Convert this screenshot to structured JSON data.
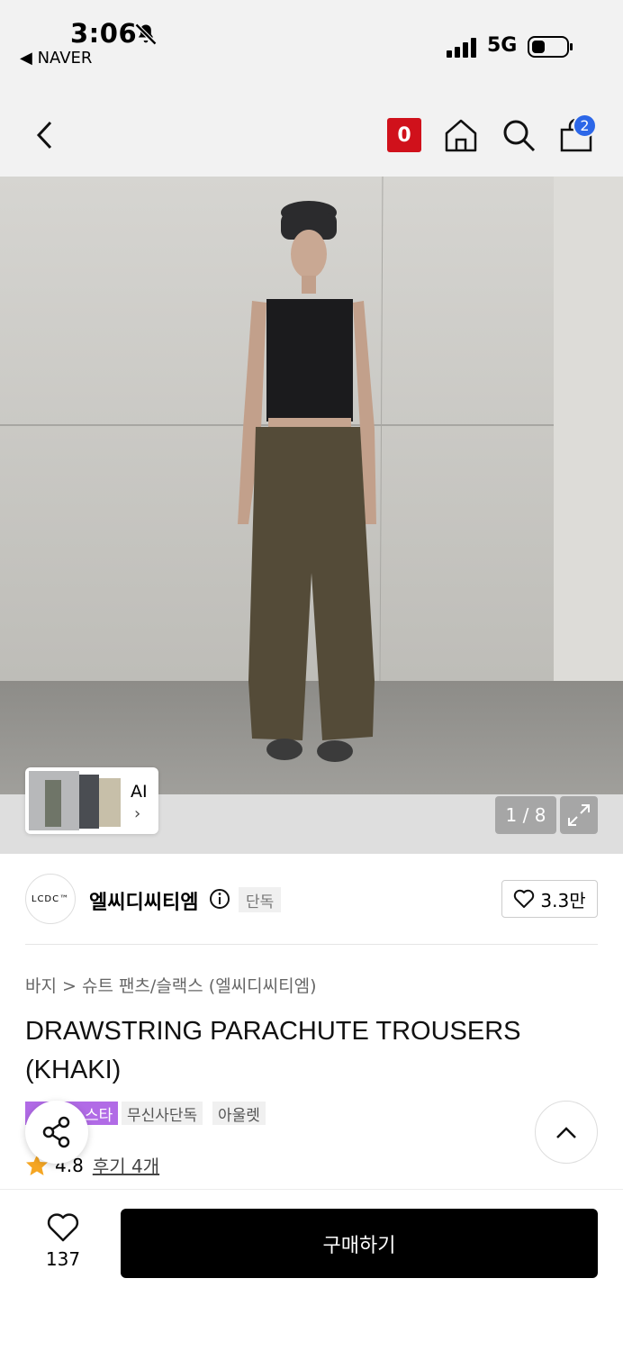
{
  "status_bar": {
    "time": "3:06",
    "back_app": "◀ NAVER",
    "network": "5G"
  },
  "header": {
    "badge_letter": "0",
    "cart_count": "2"
  },
  "gallery": {
    "ai_label": "AI",
    "ai_chevron": "›",
    "page_indicator": "1 / 8"
  },
  "brand": {
    "logo_text": "LCDC™",
    "name": "엘씨디씨티엠",
    "exclusive_label": "단독",
    "likes": "3.3만"
  },
  "product": {
    "breadcrumb": "바지 > 슈트 팬츠/슬랙스 (엘씨디씨티엠)",
    "title": "DRAWSTRING PARACHUTE TROUSERS (KHAKI)",
    "tags": [
      "무신사단독",
      "아울렛"
    ],
    "tag_partial": "스타",
    "rating": "4.8",
    "reviews": "후기 4개"
  },
  "bottom_bar": {
    "wish_count": "137",
    "buy_label": "구매하기"
  },
  "colors": {
    "accent_red": "#d0111b",
    "cart_badge": "#2c67e8",
    "tag_purple": "#b16be6",
    "star": "#f5a623"
  }
}
